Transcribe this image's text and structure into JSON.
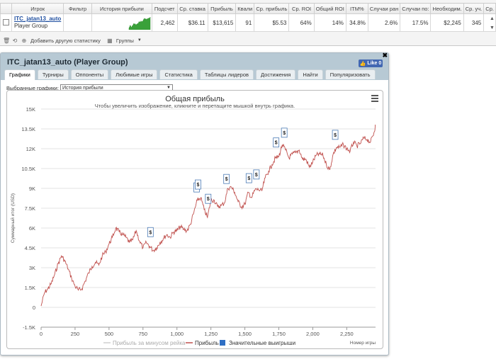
{
  "table": {
    "headers": [
      "Игрок",
      "Фильтр",
      "История прибыли",
      "Подсчет",
      "Ср. ставка",
      "Прибыль",
      "Квали",
      "Ср. прибыль",
      "Ср. ROI",
      "Общий ROI",
      "ITM%",
      "Случаи ран",
      "Случаи по:",
      "Необходим.",
      "Ср. уч.",
      "Ср."
    ],
    "row": {
      "player": "ITC_jatan13_auto",
      "group": "Player Group",
      "filter": "",
      "count": "2,462",
      "avg_stake": "$36.11",
      "profit": "$13,615",
      "quali": "91",
      "avg_profit": "$5.53",
      "avg_roi": "64%",
      "total_roi": "14%",
      "itm": "34.8%",
      "early": "2.6%",
      "late": "17.5%",
      "needed": "$2,245",
      "avg_part": "345"
    },
    "toolbar": {
      "add_stat": "Добавить другую статистику",
      "groups": "Группы"
    }
  },
  "popup": {
    "title": "ITC_jatan13_auto (Player Group)",
    "like_label": "Like 0",
    "tabs": [
      "Графики",
      "Турниры",
      "Оппоненты",
      "Любимые игры",
      "Статистика",
      "Таблицы лидеров",
      "Достижения",
      "Найти",
      "Популяризовать"
    ],
    "active_tab": 0,
    "select_label": "Выбранные графики:",
    "select_value": "История прибыли"
  },
  "chart_data": {
    "type": "line",
    "title": "Общая прибыль",
    "subtitle": "Чтобы увеличить изображение, кликните и перетащите мышкой внутрь графика.",
    "ylabel": "Суммарный итог (USD)",
    "xlabel": "Номер игры",
    "ylim": [
      -1500,
      15000
    ],
    "xlim": [
      0,
      2462
    ],
    "y_ticks": [
      -1500,
      0,
      1500,
      3000,
      4500,
      6000,
      7500,
      9000,
      10500,
      12000,
      13500,
      15000
    ],
    "y_tick_labels": [
      "-1.5K",
      "0",
      "1.5K",
      "3K",
      "4.5K",
      "6K",
      "7.5K",
      "9K",
      "10.5K",
      "12K",
      "13.5K",
      "15K"
    ],
    "x_ticks": [
      0,
      250,
      500,
      750,
      1000,
      1250,
      1500,
      1750,
      2000,
      2250
    ],
    "x_tick_labels": [
      "0",
      "250",
      "500",
      "750",
      "1,000",
      "1,250",
      "1,500",
      "1,750",
      "2,000",
      "2,250"
    ],
    "series": [
      {
        "name": "Прибыль",
        "color": "#c0504d",
        "x": [
          0,
          25,
          50,
          75,
          100,
          125,
          150,
          175,
          200,
          225,
          250,
          275,
          300,
          325,
          350,
          375,
          400,
          425,
          450,
          475,
          500,
          525,
          550,
          575,
          600,
          625,
          650,
          675,
          700,
          725,
          750,
          775,
          800,
          825,
          850,
          875,
          900,
          925,
          950,
          975,
          1000,
          1025,
          1050,
          1075,
          1100,
          1125,
          1150,
          1175,
          1200,
          1225,
          1250,
          1275,
          1300,
          1325,
          1350,
          1375,
          1400,
          1425,
          1450,
          1475,
          1500,
          1525,
          1550,
          1575,
          1600,
          1625,
          1650,
          1675,
          1700,
          1725,
          1750,
          1775,
          1800,
          1825,
          1850,
          1875,
          1900,
          1925,
          1950,
          1975,
          2000,
          2025,
          2050,
          2075,
          2100,
          2125,
          2150,
          2175,
          2200,
          2225,
          2250,
          2275,
          2300,
          2325,
          2350,
          2375,
          2400,
          2425,
          2450,
          2462
        ],
        "y": [
          100,
          1100,
          1400,
          1800,
          2500,
          3300,
          3900,
          3500,
          2900,
          2200,
          1600,
          1300,
          1400,
          2000,
          2600,
          3100,
          3400,
          3200,
          3900,
          4200,
          4800,
          5300,
          6000,
          5700,
          5500,
          5300,
          4900,
          5100,
          5800,
          5000,
          4500,
          4900,
          4600,
          4300,
          4500,
          4900,
          5200,
          5500,
          5300,
          5700,
          5800,
          6100,
          5900,
          5800,
          6300,
          7200,
          8100,
          8300,
          7400,
          6800,
          8100,
          8100,
          7600,
          7700,
          7900,
          9000,
          9100,
          8700,
          8000,
          7600,
          7800,
          8700,
          8300,
          8900,
          8900,
          8800,
          9800,
          10300,
          10800,
          11300,
          11400,
          12300,
          11900,
          11300,
          11600,
          11700,
          11900,
          11200,
          11200,
          10600,
          11000,
          11500,
          11600,
          11500,
          10800,
          10400,
          11600,
          12100,
          12100,
          12300,
          12000,
          11800,
          12500,
          12200,
          12400,
          12800,
          12700,
          12500,
          13200,
          13800
        ]
      }
    ],
    "big_wins_x": [
      805,
      1145,
      1155,
      1230,
      1365,
      1530,
      1585,
      1730,
      1790,
      2165
    ],
    "legend": [
      "Прибыль за минусом рейка",
      "Прибыль",
      "Значительные выигрыши"
    ],
    "legend_placement": "bottom",
    "marker_symbol": "$",
    "grid": true
  }
}
